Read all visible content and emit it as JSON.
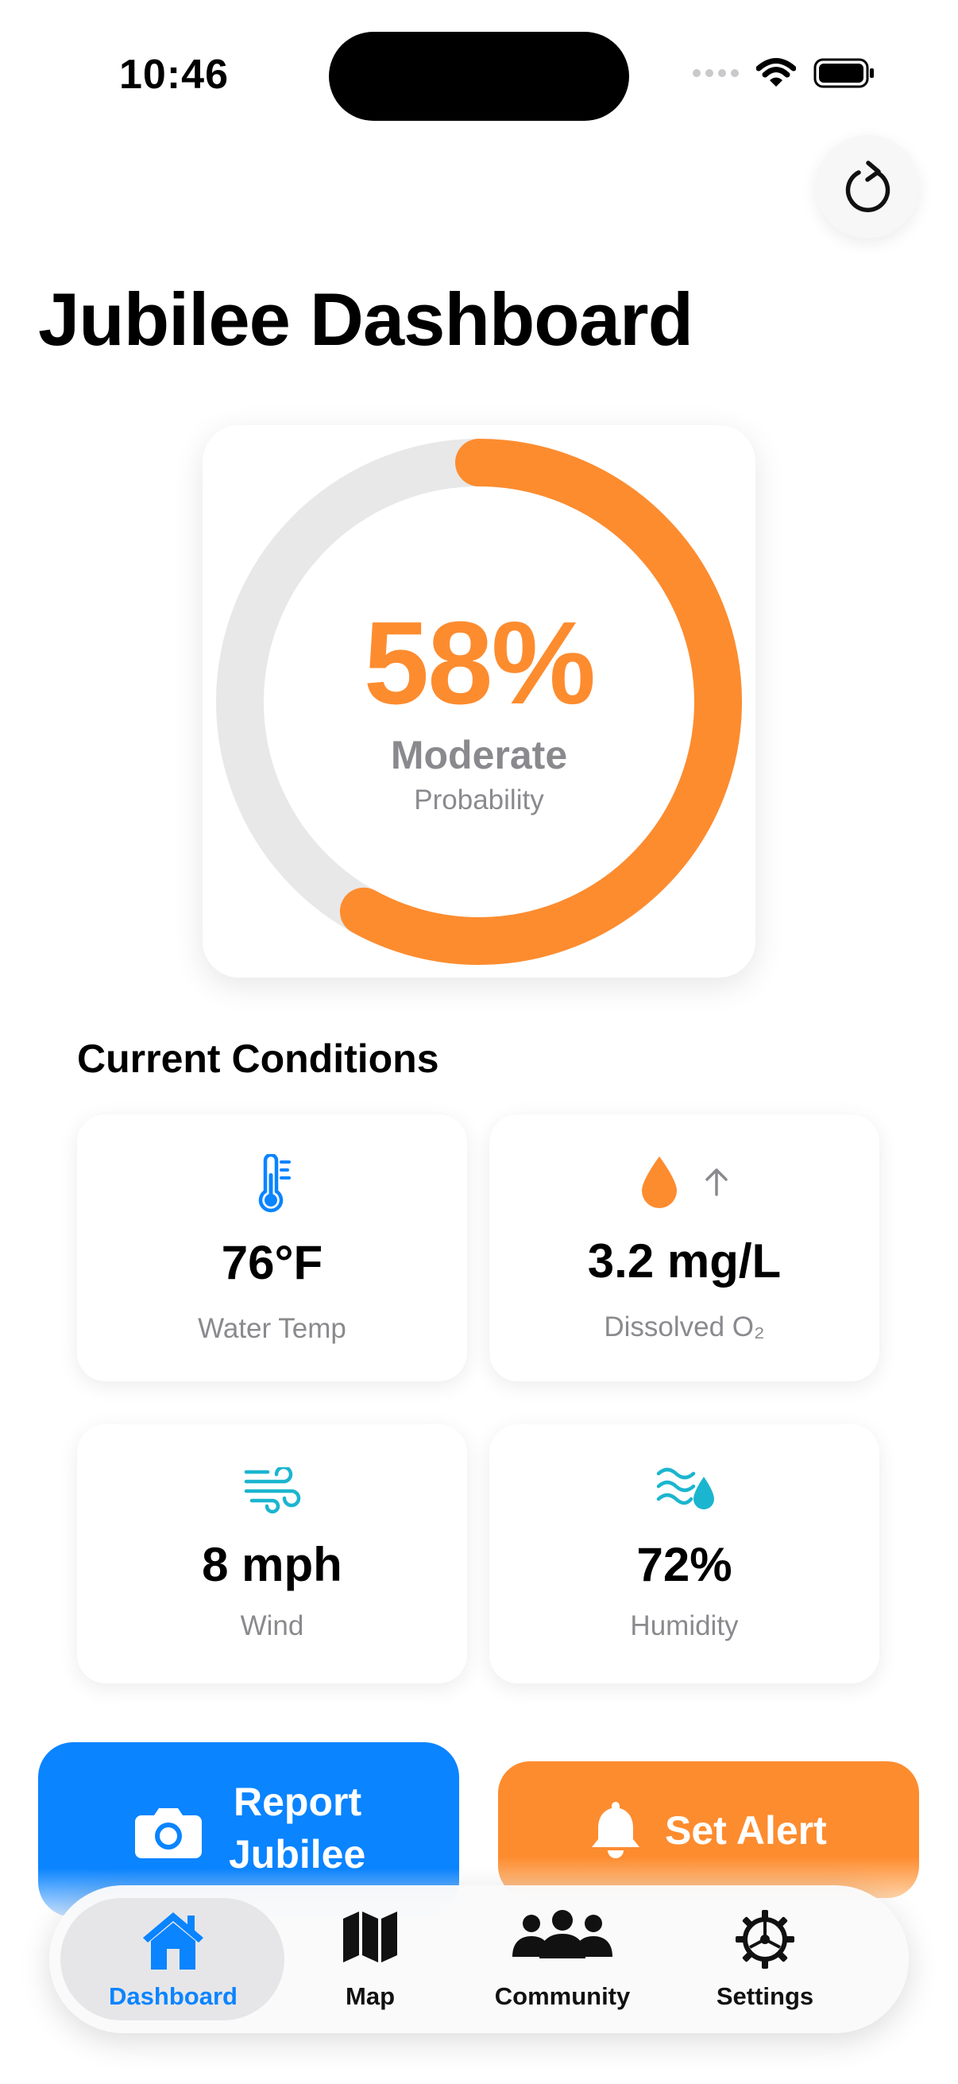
{
  "status_bar": {
    "time": "10:46"
  },
  "header": {
    "title": "Jubilee Dashboard",
    "refresh_icon": "arrow-clockwise-icon"
  },
  "probability": {
    "percent_label": "58%",
    "value": 0.58,
    "level": "Moderate",
    "caption": "Probability",
    "color": "#fd8c2f",
    "track_color": "#e8e8e8"
  },
  "conditions": {
    "title": "Current Conditions",
    "tiles": [
      {
        "icon": "thermometer-icon",
        "value": "76°F",
        "label": "Water Temp"
      },
      {
        "icon": "drop-icon",
        "trend_icon": "arrow-up-icon",
        "value": "3.2 mg/L",
        "label": "Dissolved O₂"
      },
      {
        "icon": "wind-icon",
        "value": "8 mph",
        "label": "Wind"
      },
      {
        "icon": "humidity-icon",
        "value": "72%",
        "label": "Humidity"
      }
    ]
  },
  "actions": {
    "report_line1": "Report",
    "report_line2": "Jubilee",
    "alert": "Set Alert"
  },
  "tabs": [
    {
      "label": "Dashboard",
      "icon": "house-icon",
      "active": true
    },
    {
      "label": "Map",
      "icon": "map-icon",
      "active": false
    },
    {
      "label": "Community",
      "icon": "people-icon",
      "active": false
    },
    {
      "label": "Settings",
      "icon": "gear-icon",
      "active": false
    }
  ],
  "colors": {
    "accent_blue": "#0a84ff",
    "accent_orange": "#fd8c2f",
    "teal": "#1bb5cf"
  }
}
